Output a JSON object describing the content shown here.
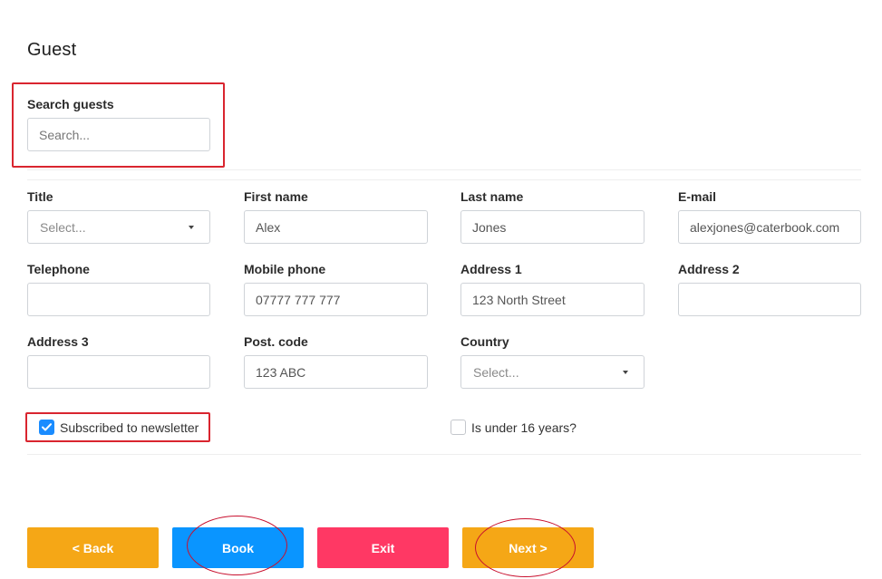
{
  "page": {
    "title": "Guest"
  },
  "search": {
    "label": "Search guests",
    "placeholder": "Search...",
    "value": ""
  },
  "form": {
    "title": {
      "label": "Title",
      "placeholder": "Select..."
    },
    "first_name": {
      "label": "First name",
      "value": "Alex"
    },
    "last_name": {
      "label": "Last name",
      "value": "Jones"
    },
    "email": {
      "label": "E-mail",
      "value": "alexjones@caterbook.com"
    },
    "telephone": {
      "label": "Telephone",
      "value": ""
    },
    "mobile_phone": {
      "label": "Mobile phone",
      "value": "07777 777 777"
    },
    "address1": {
      "label": "Address 1",
      "value": "123 North Street"
    },
    "address2": {
      "label": "Address 2",
      "value": ""
    },
    "address3": {
      "label": "Address 3",
      "value": ""
    },
    "postcode": {
      "label": "Post. code",
      "value": "123 ABC"
    },
    "country": {
      "label": "Country",
      "placeholder": "Select..."
    }
  },
  "checkboxes": {
    "newsletter": {
      "label": "Subscribed to newsletter",
      "checked": true
    },
    "under16": {
      "label": "Is under 16 years?",
      "checked": false
    }
  },
  "buttons": {
    "back": {
      "label": "< Back",
      "color": "#f5a716"
    },
    "book": {
      "label": "Book",
      "color": "#0a95ff"
    },
    "exit": {
      "label": "Exit",
      "color": "#ff3864"
    },
    "next": {
      "label": "Next >",
      "color": "#f5a716"
    }
  },
  "annotation": {
    "color": "#d9252f"
  }
}
